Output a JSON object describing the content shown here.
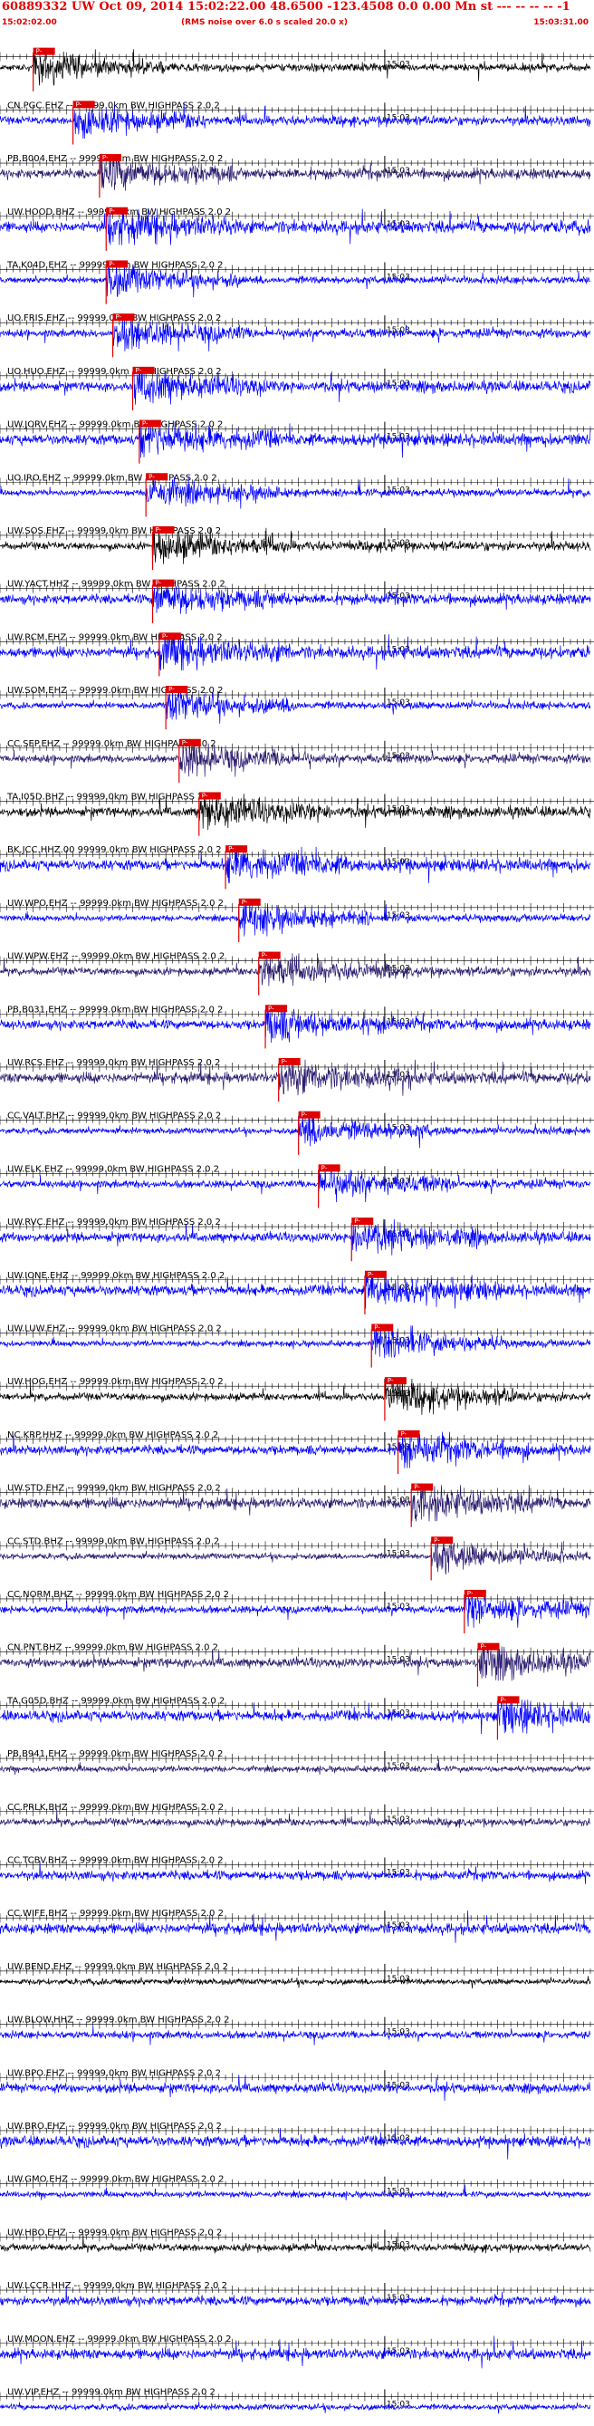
{
  "header": {
    "title": "60889332 UW Oct 09, 2014 15:02:22.00   48.6500 -123.4508  0.0 0.00 Mn st --- -- -- -- -1",
    "start_time": "15:02:02.00",
    "note": "(RMS noise over 6.0 s scaled 20.0 x)",
    "end_time": "15:03:31.00"
  },
  "chart_data": {
    "type": "seismogram",
    "time_axis": {
      "start": "15:02:02.00",
      "end": "15:03:31.00",
      "minute_mark_label": "15:03",
      "minute_mark_seconds": 58
    },
    "traces": [
      {
        "label": "",
        "marker": "P-",
        "color": "#000000",
        "pick": 5,
        "event": null
      },
      {
        "label": "CN.PGC.EHZ -- 99999.0km BW  HIGHPASS  2.0  2",
        "marker": "P-",
        "color": "#0000ff",
        "pick": 11,
        "event": null
      },
      {
        "label": "PB.B004.EHZ -- 99999.0km BW  HIGHPASS  2.0  2",
        "marker": "P-",
        "color": "#2a1a6e",
        "pick": 15,
        "event": null
      },
      {
        "label": "UW.HOOD.BHZ -- 99999.0km BW  HIGHPASS  2.0  2",
        "marker": "P-",
        "color": "#0000ff",
        "pick": 16,
        "event": null
      },
      {
        "label": "TA.K04D.EHZ -- 99999.0km BW  HIGHPASS  2.0  2",
        "marker": "P-",
        "color": "#0000ff",
        "pick": 16,
        "event": null
      },
      {
        "label": "UO.FRIS.EHZ -- 99999.0km BW  HIGHPASS  2.0  2",
        "marker": "P-",
        "color": "#0000ff",
        "pick": 17,
        "event": null
      },
      {
        "label": "UO.HUO.EHZ -- 99999.0km BW  HIGHPASS  2.0  2",
        "marker": "P-",
        "color": "#0000ff",
        "pick": 20,
        "event": null
      },
      {
        "label": "UW.JORV.EHZ -- 99999.0km BW  HIGHPASS  2.0  2",
        "marker": "P-",
        "color": "#0000ff",
        "pick": 21,
        "event": null
      },
      {
        "label": "UO.IRO.EHZ -- 99999.0km BW  HIGHPASS  2.0  2",
        "marker": "P-",
        "color": "#0000ff",
        "pick": 22,
        "event": null
      },
      {
        "label": "UW.SOS.EHZ -- 99999.0km BW  HIGHPASS  2.0  2",
        "marker": "P-",
        "color": "#000000",
        "pick": 23,
        "event": null
      },
      {
        "label": "UW.YACT.HHZ -- 99999.0km BW  HIGHPASS  2.0  2",
        "marker": "P-",
        "color": "#0000ff",
        "pick": 23,
        "event": null
      },
      {
        "label": "UW.RCM.EHZ -- 99999.0km BW  HIGHPASS  2.0  2",
        "marker": "P-",
        "color": "#0000ff",
        "pick": 24,
        "event": null
      },
      {
        "label": "UW.SOM.EHZ -- 99999.0km BW  HIGHPASS  2.0  2",
        "marker": "P-",
        "color": "#0000ff",
        "pick": 25,
        "event": null
      },
      {
        "label": "CC.SEP.EHZ -- 99999.0km BW  HIGHPASS  2.0  2",
        "marker": "P-",
        "color": "#2a1a6e",
        "pick": 27,
        "event": null
      },
      {
        "label": "TA.I05D.BHZ -- 99999.0km BW  HIGHPASS  2.0  2",
        "marker": "P-",
        "color": "#000000",
        "pick": 30,
        "event": null
      },
      {
        "label": "BK.JCC.HHZ.00 99999.0km BW  HIGHPASS  2.0  2",
        "marker": "P-",
        "color": "#0000ff",
        "pick": 34,
        "event": null
      },
      {
        "label": "UW.WPO.EHZ -- 99999.0km BW  HIGHPASS  2.0  2",
        "marker": "P-",
        "color": "#0000ff",
        "pick": 36,
        "event": null
      },
      {
        "label": "UW.WPW.EHZ -- 99999.0km BW  HIGHPASS  2.0  2",
        "marker": "P-",
        "color": "#2a1a6e",
        "pick": 39,
        "event": null
      },
      {
        "label": "PB.B031.EHZ -- 99999.0km BW  HIGHPASS  2.0  2",
        "marker": "P-",
        "color": "#0000ff",
        "pick": 40,
        "event": null
      },
      {
        "label": "UW.RCS.EHZ -- 99999.0km BW  HIGHPASS  2.0  2",
        "marker": "P-",
        "color": "#2a1a6e",
        "pick": 42,
        "event": null
      },
      {
        "label": "CC.VALT.BHZ -- 99999.0km BW  HIGHPASS  2.0  2",
        "marker": "P-",
        "color": "#0000ff",
        "pick": 45,
        "event": null
      },
      {
        "label": "UW.ELK.EHZ -- 99999.0km BW  HIGHPASS  2.0  2",
        "marker": "P-",
        "color": "#0000ff",
        "pick": 48,
        "event": null
      },
      {
        "label": "UW.RVC.EHZ -- 99999.0km BW  HIGHPASS  2.0  2",
        "marker": "P-",
        "color": "#0000ff",
        "pick": 53,
        "event": null
      },
      {
        "label": "UW.IONE.EHZ -- 99999.0km BW  HIGHPASS  2.0  2",
        "marker": "P-",
        "color": "#0000ff",
        "pick": 55,
        "event": null
      },
      {
        "label": "UW.LUW.EHZ -- 99999.0km BW  HIGHPASS  2.0  2",
        "marker": "P-",
        "color": "#0000ff",
        "pick": 56,
        "event": null
      },
      {
        "label": "UW.HOG.EHZ -- 99999.0km BW  HIGHPASS  2.0  2",
        "marker": "P-",
        "color": "#000000",
        "pick": 58,
        "event": null
      },
      {
        "label": "NC.KRP.HHZ -- 99999.0km BW  HIGHPASS  2.0  2",
        "marker": "P-",
        "color": "#0000ff",
        "pick": 60,
        "event": null
      },
      {
        "label": "UW.STD.EHZ -- 99999.0km BW  HIGHPASS  2.0  2",
        "marker": "P-",
        "color": "#2a1a6e",
        "pick": 62,
        "event": null
      },
      {
        "label": "CC.STD.BHZ -- 99999.0km BW  HIGHPASS  2.0  2",
        "marker": "P-",
        "color": "#2a1a6e",
        "pick": 65,
        "event": null
      },
      {
        "label": "CC.NORM.BHZ -- 99999.0km BW  HIGHPASS  2.0  2",
        "marker": "P-",
        "color": "#0000ff",
        "pick": 70,
        "event": null
      },
      {
        "label": "CN.PNT.BHZ -- 99999.0km BW  HIGHPASS  2.0  2",
        "marker": "P-",
        "color": "#2a1a6e",
        "pick": 72,
        "event": null
      },
      {
        "label": "TA.G05D.BHZ -- 99999.0km BW  HIGHPASS  2.0  2",
        "marker": "P-",
        "color": "#0000ff",
        "pick": 75,
        "event": null
      },
      {
        "label": "PB.B941.EHZ -- 99999.0km BW  HIGHPASS  2.0  2",
        "marker": null,
        "color": "#2a1a6e",
        "pick": null,
        "event": null
      },
      {
        "label": "CC.PRLK.BHZ -- 99999.0km BW  HIGHPASS  2.0  2",
        "marker": null,
        "color": "#2a1a6e",
        "pick": null,
        "event": null
      },
      {
        "label": "CC.TCBV.BHZ -- 99999.0km BW  HIGHPASS  2.0  2",
        "marker": null,
        "color": "#0000ff",
        "pick": null,
        "event": null
      },
      {
        "label": "CC.WIFE.BHZ -- 99999.0km BW  HIGHPASS  2.0  2",
        "marker": null,
        "color": "#0000ff",
        "pick": null,
        "event": null
      },
      {
        "label": "UW.BEND.EHZ -- 99999.0km BW  HIGHPASS  2.0  2",
        "marker": null,
        "color": "#000000",
        "pick": null,
        "event": null
      },
      {
        "label": "UW.BLOW.HHZ -- 99999.0km BW  HIGHPASS  2.0  2",
        "marker": null,
        "color": "#0000ff",
        "pick": null,
        "event": null
      },
      {
        "label": "UW.BPO.EHZ -- 99999.0km BW  HIGHPASS  2.0  2",
        "marker": null,
        "color": "#0000ff",
        "pick": null,
        "event": null
      },
      {
        "label": "UW.BRO.EHZ -- 99999.0km BW  HIGHPASS  2.0  2",
        "marker": null,
        "color": "#0000ff",
        "pick": null,
        "event": null
      },
      {
        "label": "UW.GMO.EHZ -- 99999.0km BW  HIGHPASS  2.0  2",
        "marker": null,
        "color": "#0000ff",
        "pick": null,
        "event": null
      },
      {
        "label": "UW.HBO.EHZ -- 99999.0km BW  HIGHPASS  2.0  2",
        "marker": null,
        "color": "#000000",
        "pick": null,
        "event": null
      },
      {
        "label": "UW.LCCR.HHZ -- 99999.0km BW  HIGHPASS  2.0  2",
        "marker": null,
        "color": "#0000ff",
        "pick": null,
        "event": null
      },
      {
        "label": "UW.MOON.EHZ -- 99999.0km BW  HIGHPASS  2.0  2",
        "marker": null,
        "color": "#0000ff",
        "pick": null,
        "event": null
      },
      {
        "label": "UW.VIP.EHZ -- 99999.0km BW  HIGHPASS  2.0  2",
        "marker": null,
        "color": "#0000ff",
        "pick": null,
        "event": null
      }
    ]
  }
}
